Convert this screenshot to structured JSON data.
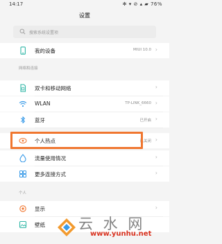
{
  "status_bar": {
    "time": "14:17",
    "right_icons": "✻ ▾ ⊘ ▴ ▰ 76%"
  },
  "page_title": "设置",
  "search": {
    "placeholder": "搜索系统设置项"
  },
  "rows": {
    "my_device": {
      "label": "我的设备",
      "value": "MIUI 10.0",
      "icon": "phone-icon"
    },
    "dual_sim": {
      "label": "双卡和移动网络",
      "icon": "sim-card-icon"
    },
    "wlan": {
      "label": "WLAN",
      "value": "TP-LINK_6660",
      "icon": "wifi-icon"
    },
    "bluetooth": {
      "label": "蓝牙",
      "value": "已开启",
      "icon": "bluetooth-icon"
    },
    "hotspot": {
      "label": "个人热点",
      "value": "已关闭",
      "icon": "hotspot-icon"
    },
    "data_usage": {
      "label": "流量使用情况",
      "icon": "data-usage-icon"
    },
    "more_connections": {
      "label": "更多连接方式",
      "icon": "more-connections-icon"
    },
    "display": {
      "label": "显示",
      "icon": "display-icon"
    },
    "wallpaper": {
      "label": "壁纸",
      "icon": "wallpaper-icon"
    }
  },
  "sections": {
    "network": "网络和连接",
    "personal": "个人"
  },
  "chevron": "›",
  "watermark": {
    "text": "云 水 网",
    "url": "www.yunhu.net"
  },
  "colors": {
    "highlight": "#f0762f",
    "accent_blue": "#3a9be8",
    "watermark_red": "#d9321f"
  }
}
